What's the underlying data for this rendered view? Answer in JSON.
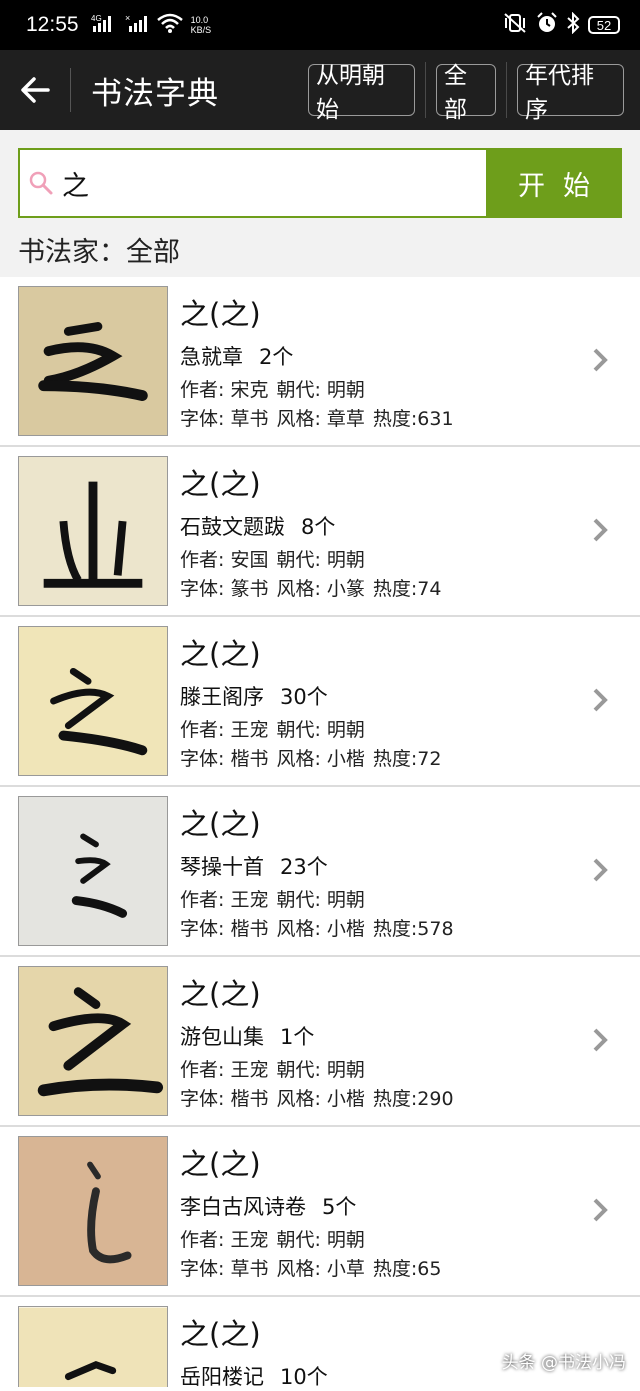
{
  "status_bar": {
    "time": "12:55",
    "network": "4G",
    "speed_value": "10.0",
    "speed_unit": "KB/S",
    "battery": "52"
  },
  "app_bar": {
    "title": "书法字典",
    "buttons": [
      "从明朝始",
      "全部",
      "年代排序"
    ]
  },
  "search": {
    "query": "之",
    "button_label": "开始",
    "filter_label": "书法家：全部"
  },
  "results": [
    {
      "char": "之(之)",
      "work": "急就章",
      "count": "2个",
      "author": "作者: 宋克",
      "dynasty": "朝代: 明朝",
      "font": "字体: 草书",
      "style": "风格: 章草",
      "heat": "热度:631",
      "thumb_bg": "#d9c9a0"
    },
    {
      "char": "之(之)",
      "work": "石鼓文题跋",
      "count": "8个",
      "author": "作者: 安国",
      "dynasty": "朝代: 明朝",
      "font": "字体: 篆书",
      "style": "风格: 小篆",
      "heat": "热度:74",
      "thumb_bg": "#ece5cc"
    },
    {
      "char": "之(之)",
      "work": "滕王阁序",
      "count": "30个",
      "author": "作者: 王宠",
      "dynasty": "朝代: 明朝",
      "font": "字体: 楷书",
      "style": "风格: 小楷",
      "heat": "热度:72",
      "thumb_bg": "#f0e5b8"
    },
    {
      "char": "之(之)",
      "work": "琴操十首",
      "count": "23个",
      "author": "作者: 王宠",
      "dynasty": "朝代: 明朝",
      "font": "字体: 楷书",
      "style": "风格: 小楷",
      "heat": "热度:578",
      "thumb_bg": "#e4e4e0"
    },
    {
      "char": "之(之)",
      "work": "游包山集",
      "count": "1个",
      "author": "作者: 王宠",
      "dynasty": "朝代: 明朝",
      "font": "字体: 楷书",
      "style": "风格: 小楷",
      "heat": "热度:290",
      "thumb_bg": "#e5d6aa"
    },
    {
      "char": "之(之)",
      "work": "李白古风诗卷",
      "count": "5个",
      "author": "作者: 王宠",
      "dynasty": "朝代: 明朝",
      "font": "字体: 草书",
      "style": "风格: 小草",
      "heat": "热度:65",
      "thumb_bg": "#d8b594"
    },
    {
      "char": "之(之)",
      "work": "岳阳楼记",
      "count": "10个",
      "author": "",
      "dynasty": "",
      "font": "",
      "style": "",
      "heat": "",
      "thumb_bg": "#efe3b8"
    }
  ],
  "watermark": "头条 @书法小冯"
}
